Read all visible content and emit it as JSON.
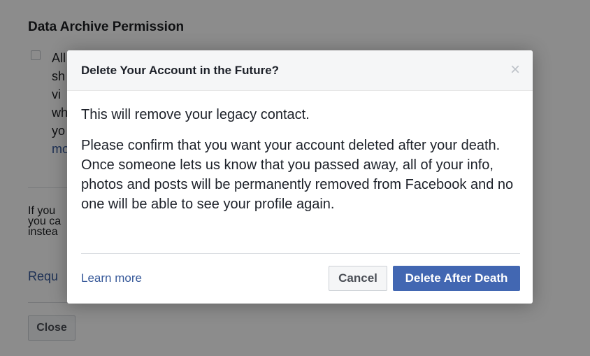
{
  "background": {
    "section_title": "Data Archive Permission",
    "checkbox_fragments": [
      "All",
      "sh",
      "vi",
      "wh",
      "yo",
      "mo"
    ],
    "info_fragments": [
      "If you",
      "you ca",
      "instea"
    ],
    "request_link": "Requ",
    "close_label": "Close"
  },
  "dialog": {
    "title": "Delete Your Account in the Future?",
    "close_glyph": "×",
    "paragraph1": "This will remove your legacy contact.",
    "paragraph2": "Please confirm that you want your account deleted after your death. Once someone lets us know that you passed away, all of your info, photos and posts will be permanently removed from Facebook and no one will be able to see your profile again.",
    "learn_more": "Learn more",
    "cancel_label": "Cancel",
    "confirm_label": "Delete After Death"
  },
  "colors": {
    "primary_button": "#4267b2",
    "link": "#365899",
    "overlay": "rgba(0,0,0,0.45)"
  }
}
